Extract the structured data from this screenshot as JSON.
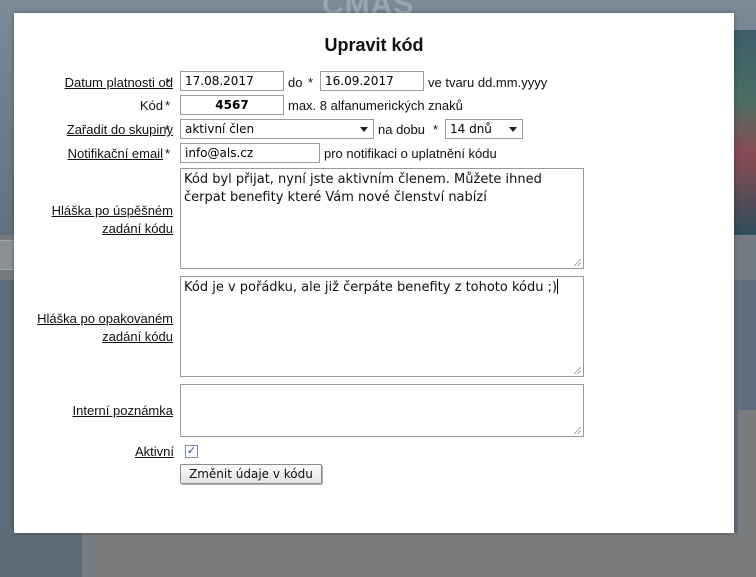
{
  "background": {
    "logo_text": "CMAS"
  },
  "modal": {
    "title": "Upravit kód",
    "required_mark": "*",
    "validity": {
      "label": "Datum platnosti od",
      "from_value": "17.08.2017",
      "to_label": "do",
      "to_value": "16.09.2017",
      "hint": "ve tvaru dd.mm.yyyy"
    },
    "code": {
      "label": "Kód",
      "value": "4567",
      "hint": "max. 8 alfanumerických znaků"
    },
    "group": {
      "label": "Zařadit do skupiny",
      "selected": "aktivní člen",
      "duration_label": "na dobu",
      "duration_selected": "14 dnů"
    },
    "notification": {
      "label": "Notifikační email",
      "value": "info@als.cz",
      "hint": "pro notifikaci o uplatnění kódu"
    },
    "success_message": {
      "label": "Hláška po úspěšném zadání kódu",
      "value": "Kód byl přijat, nyní jste aktivním členem. Můžete ihned čerpat benefity které Vám nové členství nabízí"
    },
    "repeat_message": {
      "label": "Hláška po opakovaném zadání kódu",
      "value": "Kód je v pořádku, ale již čerpáte benefity z tohoto kódu ;)"
    },
    "internal_note": {
      "label": "Interní poznámka",
      "value": ""
    },
    "active": {
      "label": "Aktivní",
      "checked": true,
      "check_glyph": "✓"
    },
    "submit_label": "Změnit údaje v kódu"
  }
}
